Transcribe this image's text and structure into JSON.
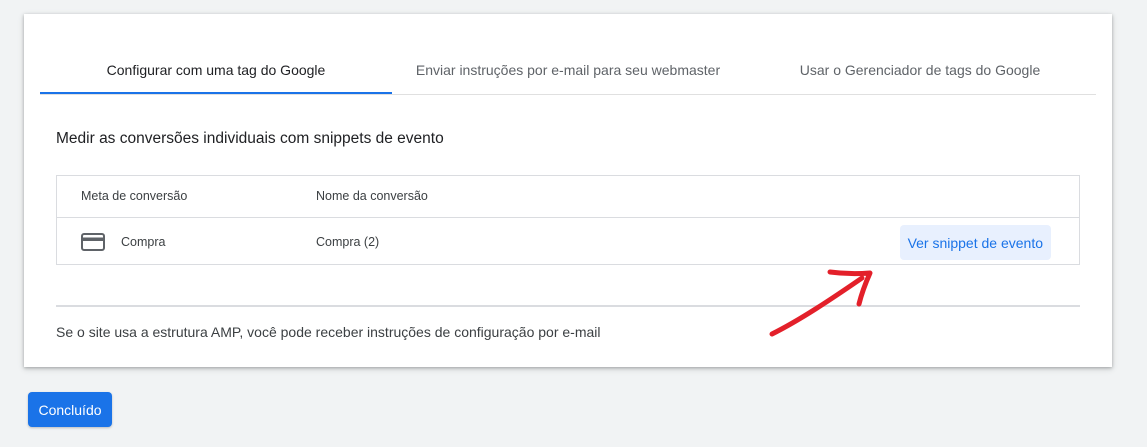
{
  "tabs": [
    {
      "label": "Configurar com uma tag do Google",
      "active": true
    },
    {
      "label": "Enviar instruções por e-mail para seu webmaster",
      "active": false
    },
    {
      "label": "Usar o Gerenciador de tags do Google",
      "active": false
    }
  ],
  "section": {
    "title": "Medir as conversões individuais com snippets de evento"
  },
  "table": {
    "headers": [
      "Meta de conversão",
      "Nome da conversão"
    ],
    "rows": [
      {
        "icon": "credit-card-icon",
        "goal": "Compra",
        "name": "Compra (2)",
        "action": "Ver snippet de evento"
      }
    ]
  },
  "amp_note": "Se o site usa a estrutura AMP, você pode receber instruções de configuração por e-mail",
  "done_button": "Concluído",
  "annotation": {
    "icon": "red-arrow-annotation"
  },
  "colors": {
    "accent": "#1a73e8",
    "accent_light_bg": "#e8f0fe",
    "background": "#f1f3f4",
    "annotation": "#e3202a"
  }
}
